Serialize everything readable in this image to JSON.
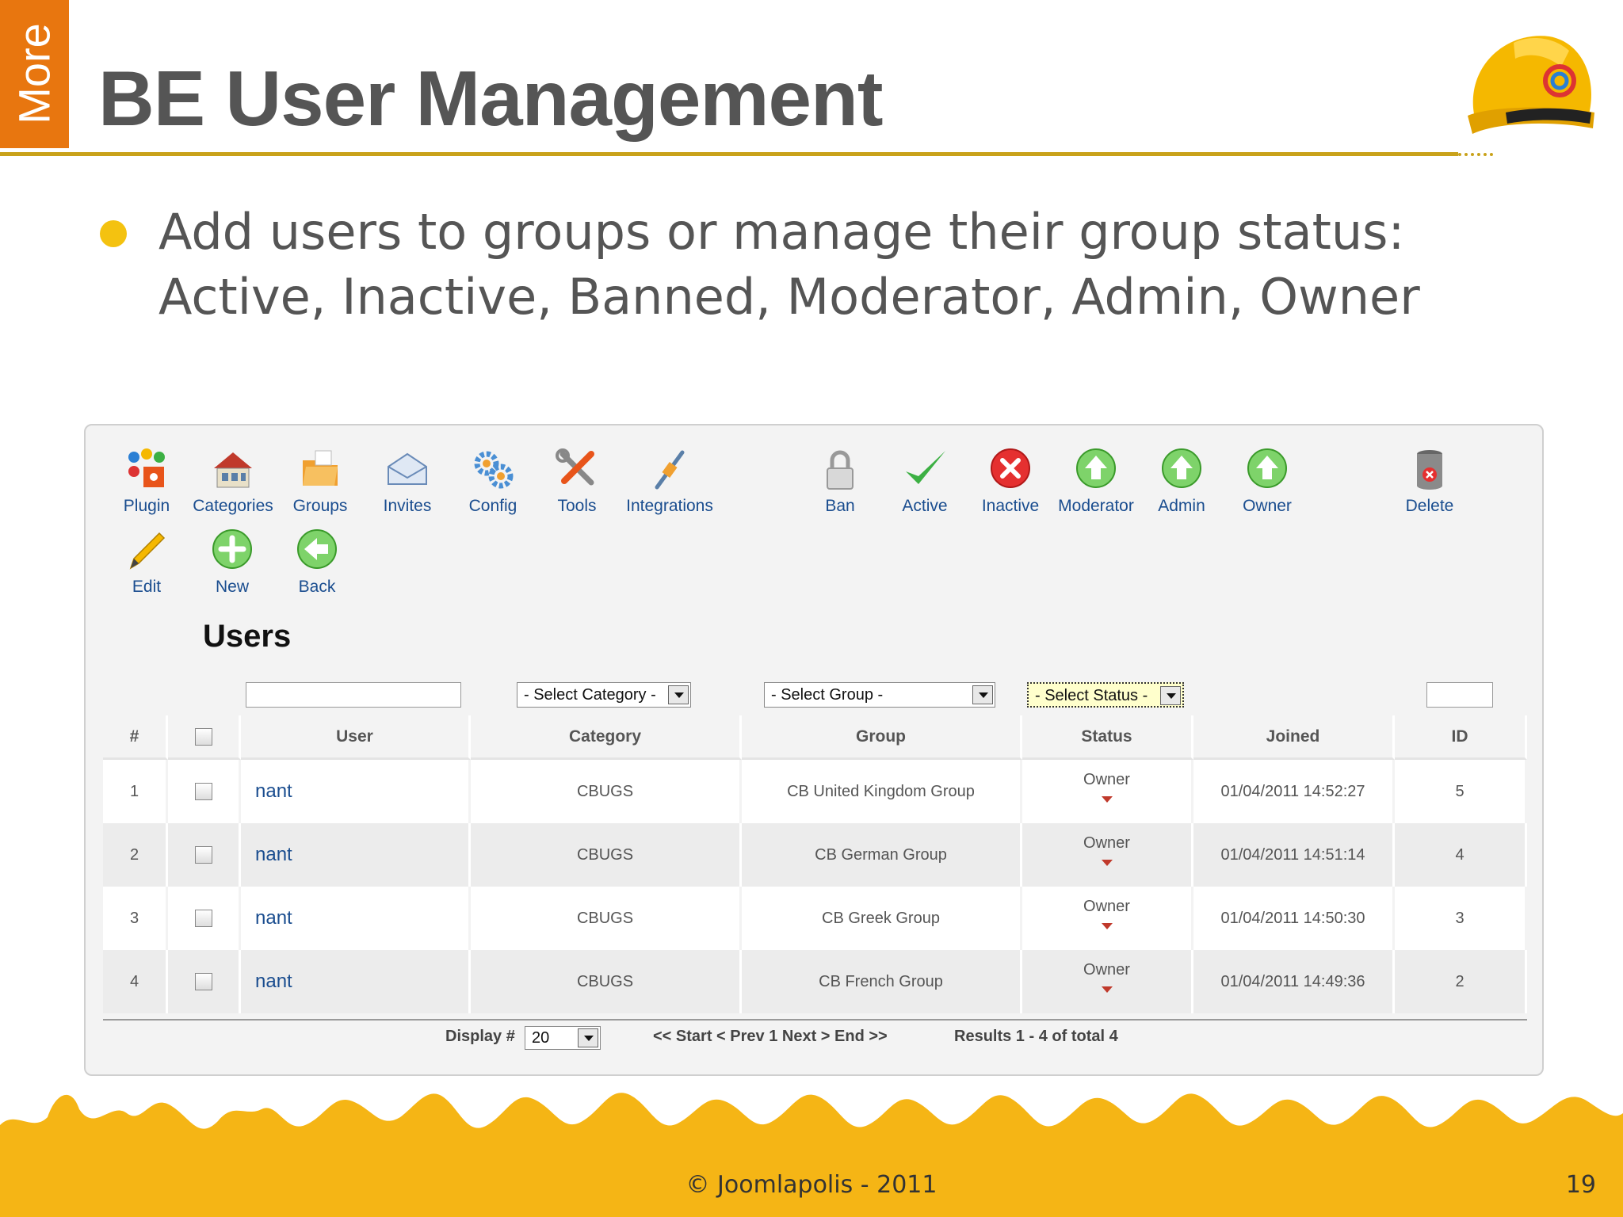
{
  "slide": {
    "side_tab": "More",
    "title": "BE User Management",
    "bullet_line1": "Add users to groups or manage their group status:",
    "bullet_line2": "Active, Inactive, Banned, Moderator, Admin, Owner",
    "footer": "© Joomlapolis - 2011",
    "page_number": "19"
  },
  "toolbar": {
    "plugin": "Plugin",
    "categories": "Categories",
    "groups": "Groups",
    "invites": "Invites",
    "config": "Config",
    "tools": "Tools",
    "integrations": "Integrations",
    "ban": "Ban",
    "active": "Active",
    "inactive": "Inactive",
    "moderator": "Moderator",
    "admin": "Admin",
    "owner": "Owner",
    "delete": "Delete",
    "edit": "Edit",
    "new": "New",
    "back": "Back"
  },
  "users": {
    "heading": "Users",
    "filters": {
      "category": "- Select Category -",
      "group": "- Select Group -",
      "status": "- Select Status -"
    },
    "columns": [
      "#",
      "User",
      "Category",
      "Group",
      "Status",
      "Joined",
      "ID"
    ],
    "rows": [
      {
        "num": "1",
        "user": "nant",
        "category": "CBUGS",
        "group": "CB United Kingdom Group",
        "status": "Owner",
        "joined": "01/04/2011 14:52:27",
        "id": "5"
      },
      {
        "num": "2",
        "user": "nant",
        "category": "CBUGS",
        "group": "CB German Group",
        "status": "Owner",
        "joined": "01/04/2011 14:51:14",
        "id": "4"
      },
      {
        "num": "3",
        "user": "nant",
        "category": "CBUGS",
        "group": "CB Greek Group",
        "status": "Owner",
        "joined": "01/04/2011 14:50:30",
        "id": "3"
      },
      {
        "num": "4",
        "user": "nant",
        "category": "CBUGS",
        "group": "CB French Group",
        "status": "Owner",
        "joined": "01/04/2011 14:49:36",
        "id": "2"
      }
    ],
    "pagination": {
      "display_label": "Display #",
      "display_value": "20",
      "nav": "<< Start < Prev 1 Next > End >>",
      "results": "Results 1 - 4 of total 4"
    }
  }
}
